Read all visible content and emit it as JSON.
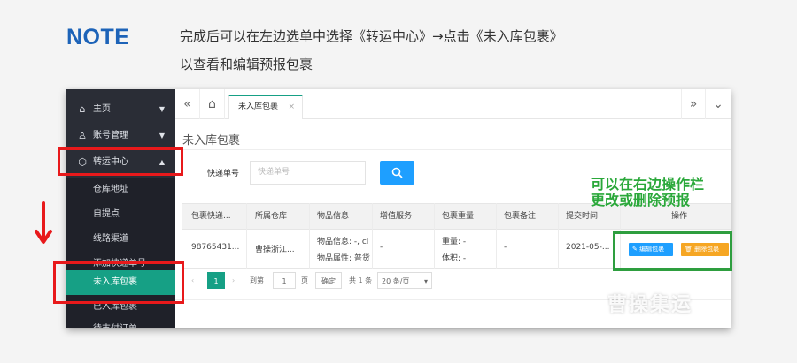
{
  "note": {
    "title": "NOTE",
    "line1": "完成后可以在左边选单中选择《转运中心》→点击《未入库包裹》",
    "line2": "以查看和编辑预报包裹"
  },
  "sidebar": {
    "items": [
      {
        "label": "主页",
        "icon": "home-icon"
      },
      {
        "label": "账号管理",
        "icon": "user-icon"
      },
      {
        "label": "转运中心",
        "icon": "box-icon"
      }
    ],
    "subitems": [
      "仓库地址",
      "自提点",
      "线路渠道",
      "添加快递单号",
      "未入库包裹",
      "已入库包裹",
      "待支付订单"
    ],
    "active_subitem": "未入库包裹"
  },
  "tabs": {
    "active_label": "未入库包裹",
    "close_glyph": "×"
  },
  "page": {
    "title": "未入库包裹"
  },
  "search": {
    "label": "快递单号",
    "placeholder": "快递单号"
  },
  "table": {
    "headers": [
      "包裹快递...",
      "所属仓库",
      "物品信息",
      "增值服务",
      "包裹重量",
      "包裹备注",
      "提交时间",
      "操作"
    ],
    "row": {
      "tracking": "98765431...",
      "warehouse": "曹操浙江...",
      "item_info_1": "物品信息: -, cl",
      "item_info_2": "物品属性: 普货",
      "service": "-",
      "weight": "重量: -",
      "volume": "体积: -",
      "remark": "-",
      "time": "2021-05-...",
      "edit_label": "编辑包裹",
      "delete_label": "删除包裹"
    }
  },
  "pagination": {
    "current_page": "1",
    "goto_label": "到第",
    "goto_value": "1",
    "page_unit": "页",
    "confirm_label": "确定",
    "total_label": "共 1 条",
    "page_size": "20 条/页"
  },
  "annotation": {
    "line1": "可以在右边操作栏",
    "line2": "更改或删除预报"
  },
  "watermark": "曹操集运",
  "colors": {
    "note_title": "#1d63b8",
    "sidebar_bg": "#2a2d36",
    "active_green": "#16a085",
    "primary_blue": "#1e9fff",
    "delete_orange": "#f6a623",
    "highlight_red": "#e8191b",
    "annotation_green": "#2aa83a"
  }
}
